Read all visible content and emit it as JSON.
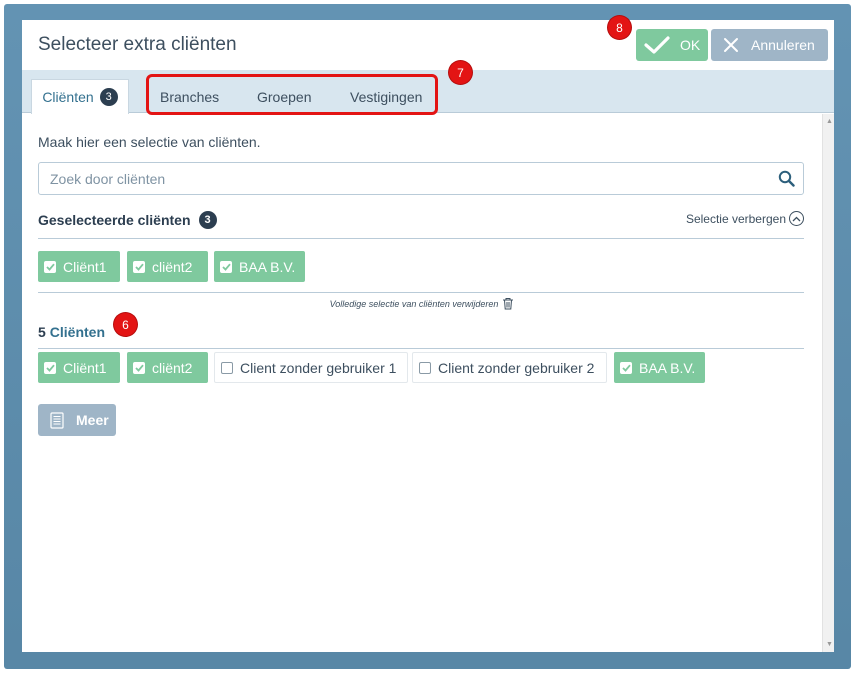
{
  "dialog": {
    "title": "Selecteer extra cliënten",
    "ok_label": "OK",
    "cancel_label": "Annuleren"
  },
  "tabs": [
    {
      "label": "Cliënten",
      "badge": "3",
      "active": true
    },
    {
      "label": "Branches"
    },
    {
      "label": "Groepen"
    },
    {
      "label": "Vestigingen"
    }
  ],
  "content": {
    "intro": "Maak hier een selectie van cliënten.",
    "search_placeholder": "Zoek door cliënten",
    "selected_title": "Geselecteerde cliënten",
    "selected_count": "3",
    "toggle_label": "Selectie verbergen",
    "selected_chips": [
      "Cliënt1",
      "cliënt2",
      "BAA B.V."
    ],
    "clear_label": "Volledige selectie van cliënten verwijderen",
    "list_count": "5",
    "list_word": "Cliënten",
    "list_chips": [
      {
        "label": "Cliënt1",
        "checked": true
      },
      {
        "label": "cliënt2",
        "checked": true
      },
      {
        "label": "Client zonder gebruiker 1",
        "checked": false
      },
      {
        "label": "Client zonder gebruiker 2",
        "checked": false
      },
      {
        "label": "BAA B.V.",
        "checked": true
      }
    ],
    "more_label": "Meer"
  },
  "callouts": [
    "6",
    "7",
    "8"
  ],
  "colors": {
    "accent_green": "#7fc99e",
    "muted_blue": "#9fb5c7",
    "tabbar": "#d8e6ef",
    "frame": "#5d8fb0",
    "callout_red": "#e31414"
  },
  "icons": [
    "check-icon",
    "close-icon",
    "search-icon",
    "chevron-up-icon",
    "trash-icon",
    "checkbox-icon",
    "document-icon"
  ]
}
